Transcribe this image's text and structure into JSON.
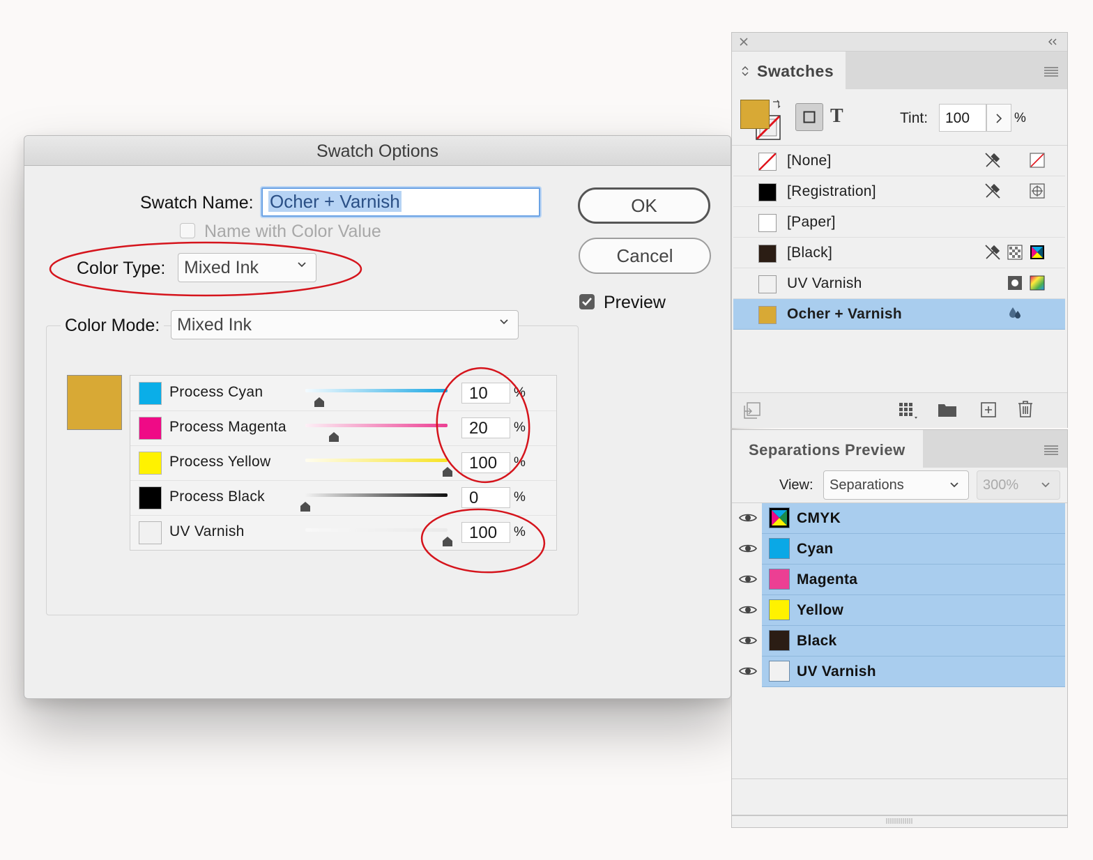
{
  "dialog": {
    "title": "Swatch Options",
    "swatch_name_label": "Swatch Name:",
    "swatch_name_value": "Ocher + Varnish",
    "name_with_color_value_label": "Name with Color Value",
    "color_type_label": "Color Type:",
    "color_type_value": "Mixed Ink",
    "color_mode_label": "Color Mode:",
    "color_mode_value": "Mixed Ink",
    "ok_label": "OK",
    "cancel_label": "Cancel",
    "preview_label": "Preview",
    "preview_checked": true,
    "preview_color": "#d8a935",
    "inks": [
      {
        "name": "Process Cyan",
        "color": "#0aaee8",
        "value": "10",
        "pct": "%",
        "track": "linear-gradient(90deg,#f4fbff,#1aa7e3)",
        "thumb_fraction": 0.1
      },
      {
        "name": "Process Magenta",
        "color": "#ef0a86",
        "value": "20",
        "pct": "%",
        "track": "linear-gradient(90deg,#fdf0f6,#ec3f93)",
        "thumb_fraction": 0.2
      },
      {
        "name": "Process Yellow",
        "color": "#fff200",
        "value": "100",
        "pct": "%",
        "track": "linear-gradient(90deg,#fffdf0,#f7e324)",
        "thumb_fraction": 1.0
      },
      {
        "name": "Process Black",
        "color": "#000000",
        "value": "0",
        "pct": "%",
        "track": "linear-gradient(90deg,#f2f2f2,#111111)",
        "thumb_fraction": 0.0
      },
      {
        "name": "UV Varnish",
        "color": "#f1f1f1",
        "value": "100",
        "pct": "%",
        "track": "linear-gradient(90deg,#f8f8f8,#e9e9e9)",
        "thumb_fraction": 1.0
      }
    ]
  },
  "swatches_panel": {
    "tab_label": "Swatches",
    "fill_color": "#d8a935",
    "tint_label": "Tint:",
    "tint_value": "100",
    "tint_pct": "%",
    "items": [
      {
        "name": "[None]",
        "chip": "none",
        "selected": false
      },
      {
        "name": "[Registration]",
        "chip": "#000000",
        "selected": false
      },
      {
        "name": "[Paper]",
        "chip": "#ffffff",
        "selected": false
      },
      {
        "name": "[Black]",
        "chip": "#2b1d14",
        "selected": false
      },
      {
        "name": "UV Varnish",
        "chip": "#f1f1f1",
        "selected": false
      },
      {
        "name": "Ocher + Varnish",
        "chip": "#d8a935",
        "selected": true
      }
    ]
  },
  "separations_panel": {
    "tab_label": "Separations Preview",
    "view_label": "View:",
    "view_value": "Separations",
    "zoom_value": "300%",
    "items": [
      {
        "name": "CMYK",
        "chip": "cmyk"
      },
      {
        "name": "Cyan",
        "chip": "#0aa8e6"
      },
      {
        "name": "Magenta",
        "chip": "#ec3f93"
      },
      {
        "name": "Yellow",
        "chip": "#fff200"
      },
      {
        "name": "Black",
        "chip": "#2b1d14"
      },
      {
        "name": "UV Varnish",
        "chip": "#f1f1f1"
      }
    ]
  },
  "annotation_color": "#d5141c"
}
